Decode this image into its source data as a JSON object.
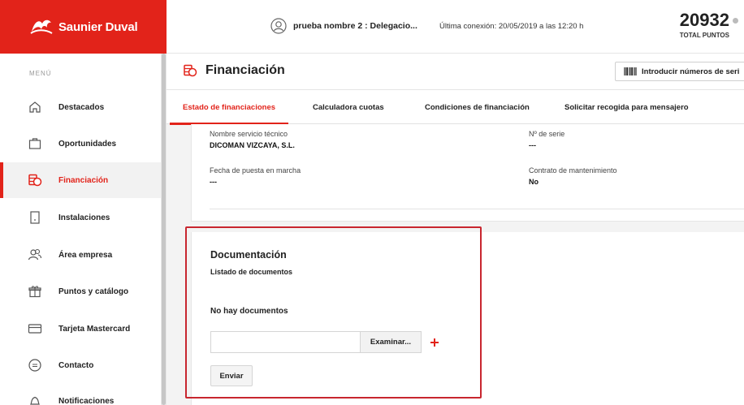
{
  "brand": {
    "name": "Saunier Duval"
  },
  "header": {
    "user": "prueba nombre 2 : Delegacio...",
    "last_login": "Última conexión: 20/05/2019 a las 12:20 h",
    "points_value": "20932",
    "points_label": "TOTAL PUNTOS"
  },
  "sidebar": {
    "title": "MENÚ",
    "items": [
      {
        "label": "Destacados",
        "icon": "home-icon"
      },
      {
        "label": "Oportunidades",
        "icon": "briefcase-icon"
      },
      {
        "label": "Financiación",
        "icon": "coins-icon",
        "active": true
      },
      {
        "label": "Instalaciones",
        "icon": "device-icon"
      },
      {
        "label": "Área empresa",
        "icon": "users-icon"
      },
      {
        "label": "Puntos y catálogo",
        "icon": "gift-icon"
      },
      {
        "label": "Tarjeta Mastercard",
        "icon": "card-icon"
      },
      {
        "label": "Contacto",
        "icon": "chat-icon"
      },
      {
        "label": "Notificaciones",
        "icon": "bell-icon"
      }
    ]
  },
  "page": {
    "title": "Financiación",
    "serial_button": "Introducir números de seri"
  },
  "tabs": [
    {
      "label": "Estado de financiaciones",
      "active": true
    },
    {
      "label": "Calculadora cuotas"
    },
    {
      "label": "Condiciones de financiación"
    },
    {
      "label": "Solicitar recogida para mensajero"
    }
  ],
  "info": {
    "service_label": "Nombre servicio técnico",
    "service_value": "DICOMAN VIZCAYA, S.L.",
    "serial_label": "Nº de serie",
    "serial_value": "---",
    "start_label": "Fecha de puesta en marcha",
    "start_value": "---",
    "contract_label": "Contrato de mantenimiento",
    "contract_value": "No"
  },
  "docs": {
    "title": "Documentación",
    "subtitle": "Listado de documentos",
    "empty": "No hay documentos",
    "browse": "Examinar...",
    "send": "Enviar"
  },
  "colors": {
    "brand": "#e2231a",
    "highlight": "#c8262f"
  }
}
